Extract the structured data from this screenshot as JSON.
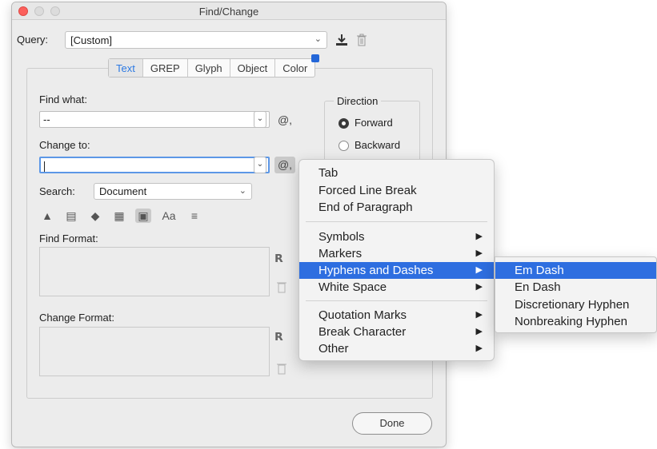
{
  "window": {
    "title": "Find/Change"
  },
  "query": {
    "label": "Query:",
    "value": "[Custom]"
  },
  "tabs": [
    {
      "label": "Text",
      "active": true
    },
    {
      "label": "GREP"
    },
    {
      "label": "Glyph"
    },
    {
      "label": "Object"
    },
    {
      "label": "Color"
    }
  ],
  "find_what": {
    "label": "Find what:",
    "value": "--"
  },
  "change_to": {
    "label": "Change to:",
    "value": ""
  },
  "direction": {
    "title": "Direction",
    "forward": "Forward",
    "backward": "Backward",
    "selected": "Forward"
  },
  "search": {
    "label": "Search:",
    "value": "Document"
  },
  "find_format": {
    "label": "Find Format:"
  },
  "change_format": {
    "label": "Change Format:"
  },
  "buttons": {
    "done": "Done",
    "at_symbol": "@,"
  },
  "options_icons": [
    "lock-layers-icon",
    "lock-stories-icon",
    "hidden-layers-icon",
    "master-pages-icon",
    "footnotes-icon",
    "case-sensitive-icon",
    "whole-word-icon"
  ],
  "options_case_label": "Aa",
  "special_menu": {
    "items": [
      "Tab",
      "Forced Line Break",
      "End of Paragraph"
    ],
    "items2": [
      "Symbols",
      "Markers",
      "Hyphens and Dashes",
      "White Space"
    ],
    "items3": [
      "Quotation Marks",
      "Break Character",
      "Other"
    ]
  },
  "submenu": {
    "items": [
      "Em Dash",
      "En Dash",
      "Discretionary Hyphen",
      "Nonbreaking Hyphen"
    ]
  },
  "colors": {
    "accent": "#2e6ee0",
    "tab_active": "#2d7ae3",
    "close": "#fc605c"
  }
}
